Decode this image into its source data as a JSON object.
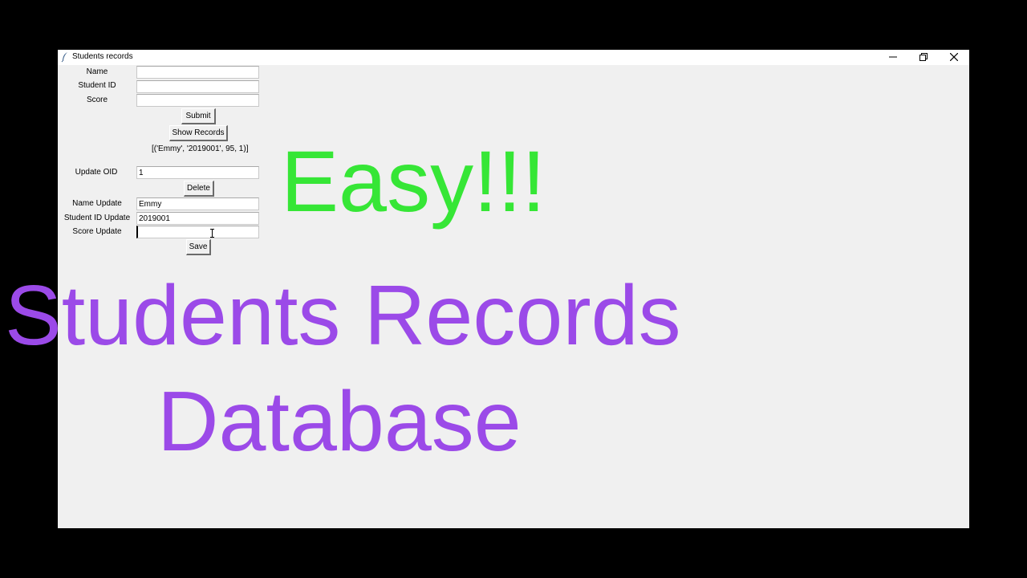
{
  "window": {
    "title": "Students records",
    "controls": {
      "minimize": "minimize-icon",
      "restore": "restore-icon",
      "close": "close-icon"
    }
  },
  "form": {
    "name_label": "Name",
    "student_id_label": "Student ID",
    "score_label": "Score",
    "name_value": "",
    "student_id_value": "",
    "score_value": "",
    "submit_label": "Submit",
    "show_records_label": "Show Records",
    "records_output": "[('Emmy', '2019001', 95, 1)]",
    "update_oid_label": "Update OID",
    "update_oid_value": "1",
    "delete_label": "Delete",
    "name_update_label": "Name Update",
    "name_update_value": "Emmy",
    "student_id_update_label": "Student ID Update",
    "student_id_update_value": "2019001",
    "score_update_label": "Score Update",
    "score_update_value": "",
    "save_label": "Save"
  },
  "overlay": {
    "headline": "Easy!!!",
    "title_line1": "Students Records",
    "title_line2": "Database"
  },
  "colors": {
    "window_bg": "#f0f0f0",
    "headline": "#36e636",
    "title": "#9b4ae8"
  }
}
